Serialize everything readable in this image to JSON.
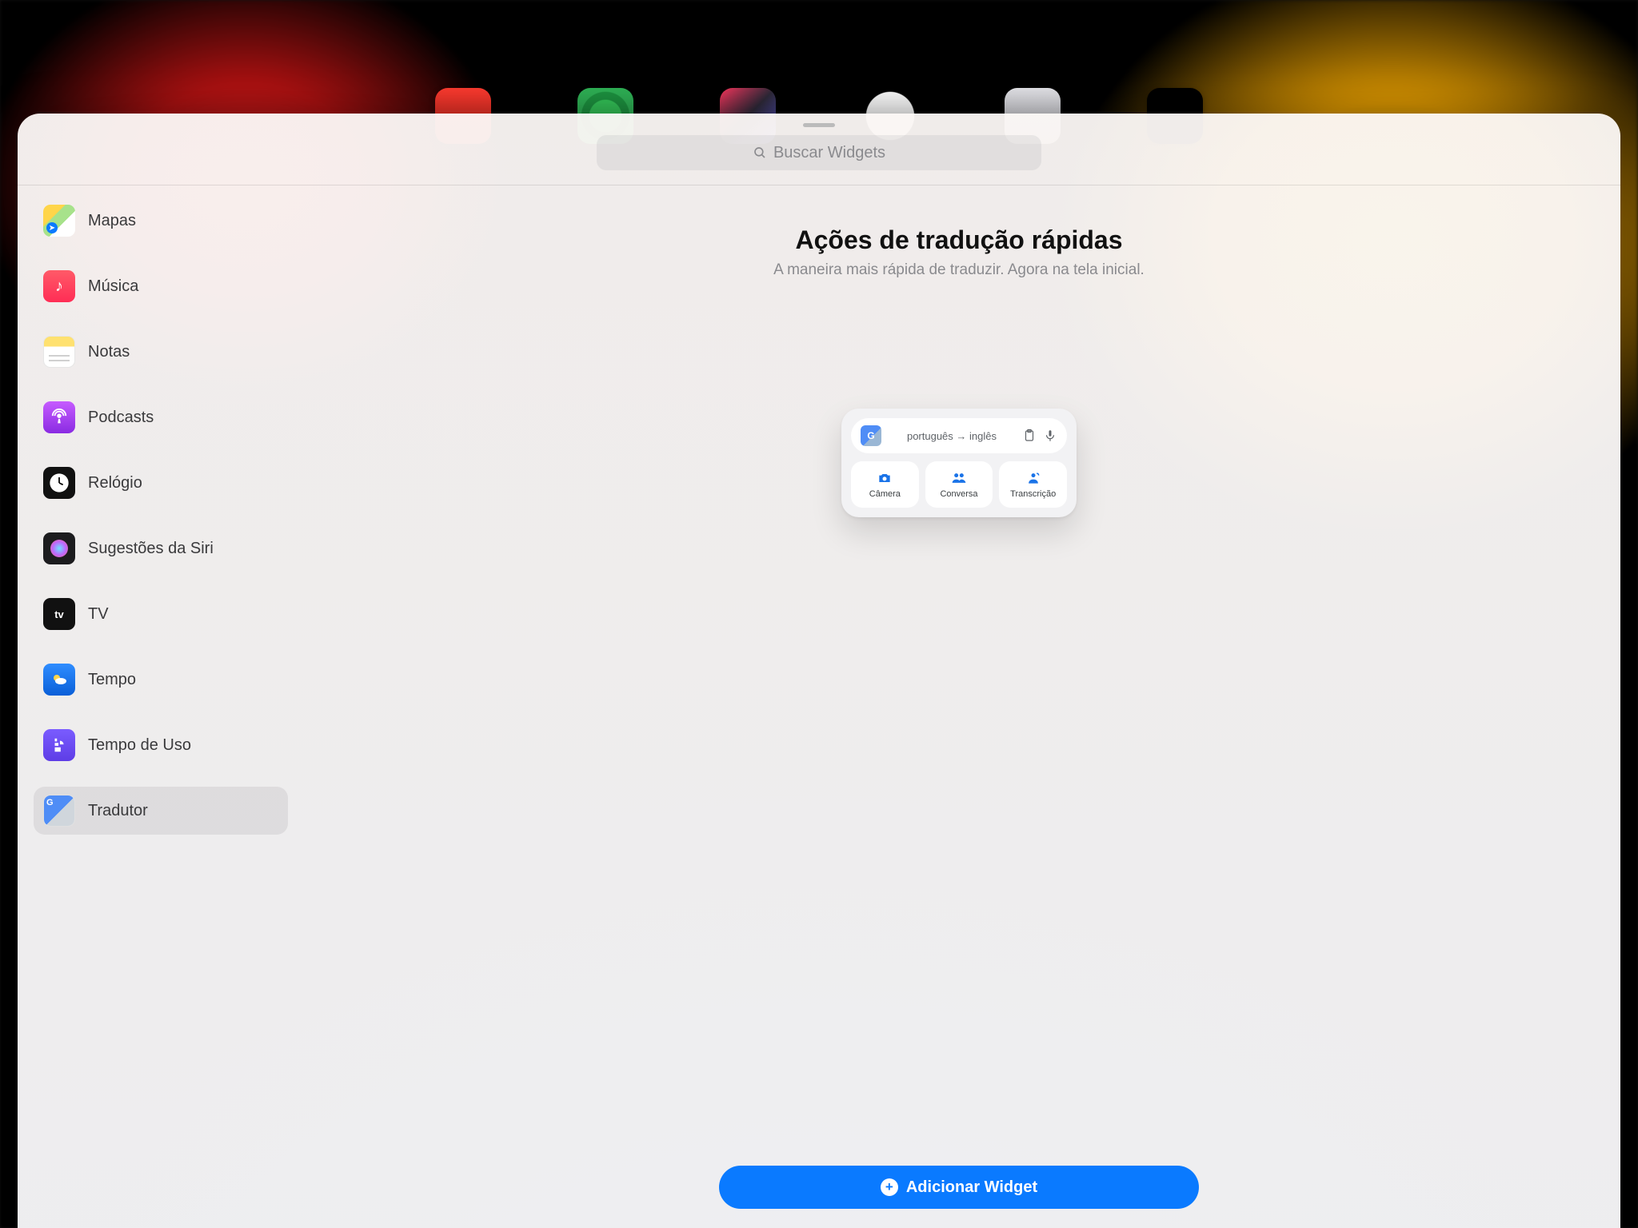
{
  "search": {
    "placeholder": "Buscar Widgets"
  },
  "sidebar": {
    "items": [
      {
        "id": "mapas",
        "label": "Mapas"
      },
      {
        "id": "musica",
        "label": "Música"
      },
      {
        "id": "notas",
        "label": "Notas"
      },
      {
        "id": "podcasts",
        "label": "Podcasts"
      },
      {
        "id": "relogio",
        "label": "Relógio"
      },
      {
        "id": "siri",
        "label": "Sugestões da Siri"
      },
      {
        "id": "tv",
        "label": "TV"
      },
      {
        "id": "tempo",
        "label": "Tempo"
      },
      {
        "id": "tempouso",
        "label": "Tempo de Uso"
      },
      {
        "id": "tradutor",
        "label": "Tradutor",
        "selected": true
      }
    ]
  },
  "main": {
    "title": "Ações de tradução rápidas",
    "subtitle": "A maneira mais rápida de traduzir. Agora na tela inicial.",
    "add_label": "Adicionar Widget"
  },
  "widget": {
    "lang_from": "português",
    "lang_to": "inglês",
    "tiles": [
      {
        "id": "camera",
        "label": "Câmera"
      },
      {
        "id": "conversa",
        "label": "Conversa"
      },
      {
        "id": "transcricao",
        "label": "Transcrição"
      }
    ]
  }
}
